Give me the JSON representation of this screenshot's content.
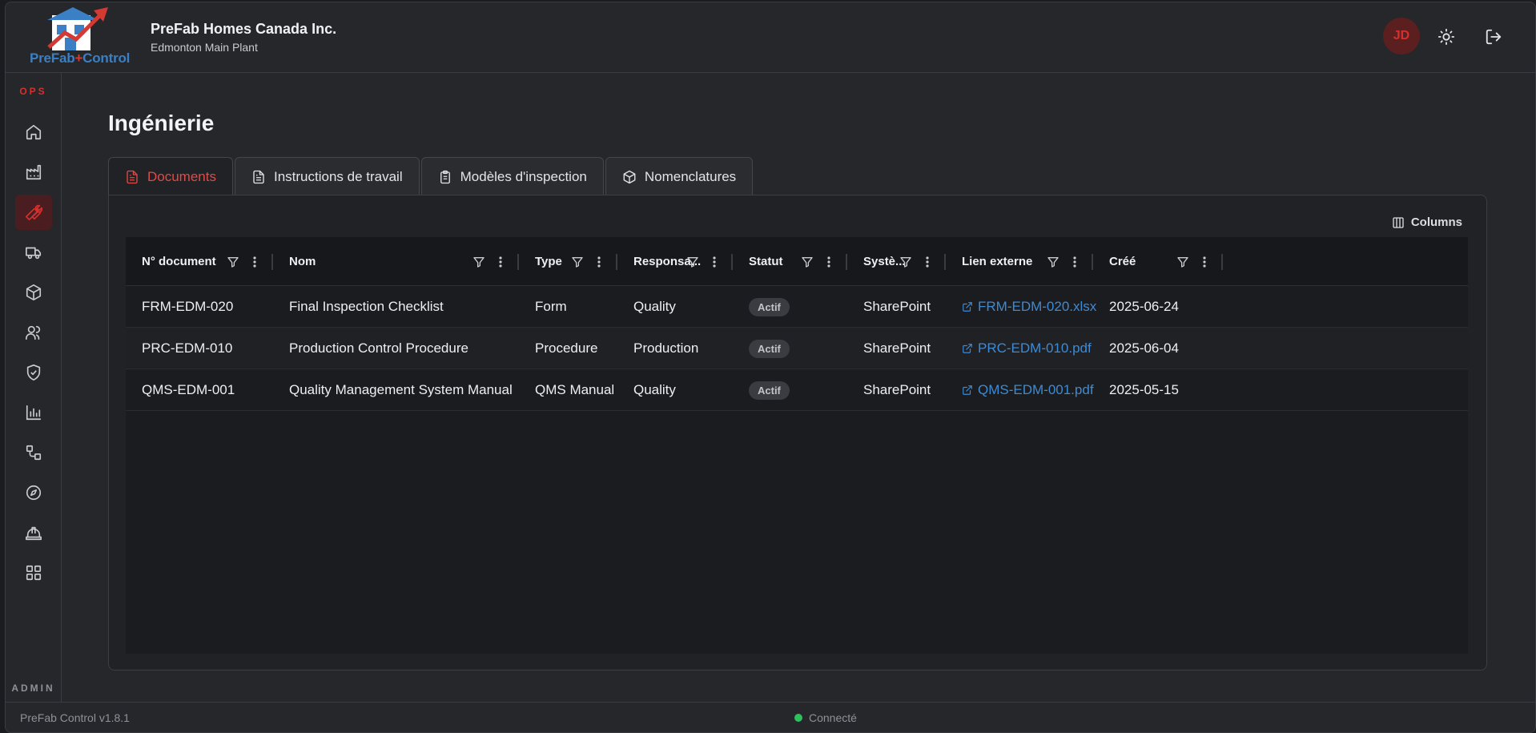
{
  "header": {
    "logo_text_a": "PreFab",
    "logo_text_plus": "+",
    "logo_text_b": "Control",
    "company_name": "PreFab Homes Canada Inc.",
    "plant_name": "Edmonton Main Plant",
    "avatar_initials": "JD"
  },
  "sidebar": {
    "ops_label": "OPS",
    "admin_label": "ADMIN",
    "items": [
      {
        "icon": "home-icon"
      },
      {
        "icon": "factory-icon"
      },
      {
        "icon": "wrench-icon",
        "active": true
      },
      {
        "icon": "truck-icon"
      },
      {
        "icon": "package-icon"
      },
      {
        "icon": "users-icon"
      },
      {
        "icon": "shield-check-icon"
      },
      {
        "icon": "bar-chart-icon"
      },
      {
        "icon": "workflow-icon"
      },
      {
        "icon": "compass-icon"
      },
      {
        "icon": "hard-hat-icon"
      },
      {
        "icon": "grid-icon"
      }
    ]
  },
  "page": {
    "title": "Ingénierie",
    "tabs": [
      {
        "label": "Documents",
        "active": true
      },
      {
        "label": "Instructions de travail"
      },
      {
        "label": "Modèles d'inspection"
      },
      {
        "label": "Nomenclatures"
      }
    ],
    "columns_button": "Columns"
  },
  "table": {
    "headers": [
      "N° document",
      "Nom",
      "Type",
      "Responsa...",
      "Statut",
      "Systè...",
      "Lien externe",
      "Créé"
    ],
    "rows": [
      [
        "FRM-EDM-020",
        "Final Inspection Checklist",
        "Form",
        "Quality",
        "Actif",
        "SharePoint",
        "FRM-EDM-020.xlsx",
        "2025-06-24"
      ],
      [
        "PRC-EDM-010",
        "Production Control Procedure",
        "Procedure",
        "Production",
        "Actif",
        "SharePoint",
        "PRC-EDM-010.pdf",
        "2025-06-04"
      ],
      [
        "QMS-EDM-001",
        "Quality Management System Manual",
        "QMS Manual",
        "Quality",
        "Actif",
        "SharePoint",
        "QMS-EDM-001.pdf",
        "2025-05-15"
      ]
    ]
  },
  "footer": {
    "version": "PreFab Control v1.8.1",
    "connection_status": "Connecté"
  },
  "colors": {
    "accent_red": "#d6302e",
    "link_blue": "#3d8bd4",
    "status_green": "#2fbf5d",
    "background": "#25272b"
  }
}
